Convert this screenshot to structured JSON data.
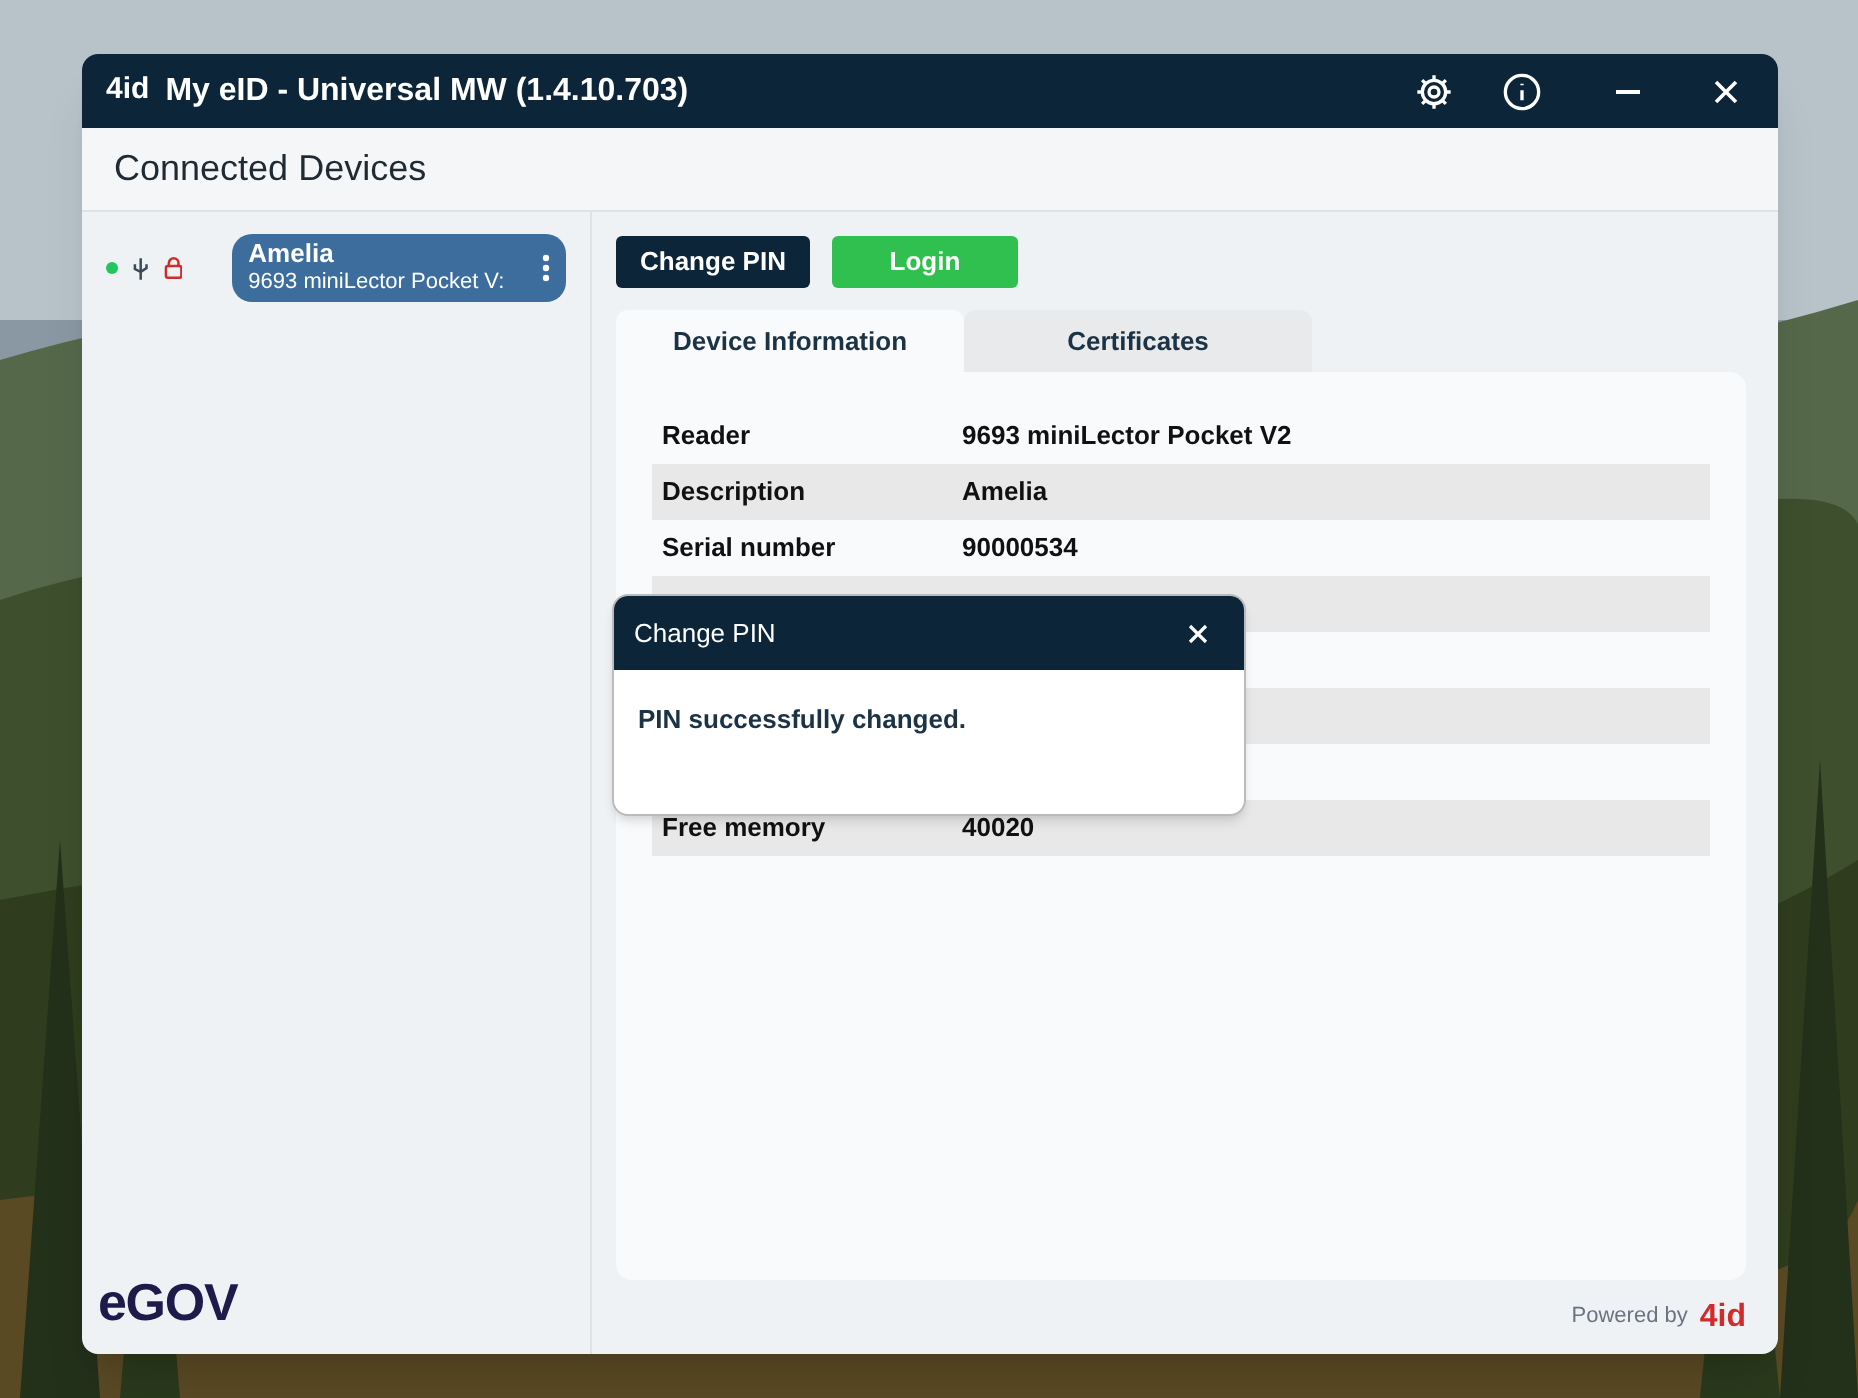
{
  "window": {
    "logo": "4id",
    "title": "My eID - Universal MW (1.4.10.703)"
  },
  "header": {
    "title": "Connected Devices"
  },
  "devices": [
    {
      "name": "Amelia",
      "reader": "9693 miniLector Pocket V:",
      "connected": true,
      "locked": true,
      "selected": true
    }
  ],
  "actions": [
    {
      "label": "Change PIN",
      "kind": "primary"
    },
    {
      "label": "Login",
      "kind": "success"
    }
  ],
  "tabs": [
    {
      "label": "Device Information",
      "selected": true
    },
    {
      "label": "Certificates",
      "selected": false
    }
  ],
  "table": {
    "rows": [
      {
        "kind": "info",
        "label": "Reader",
        "value": "9693 miniLector Pocket V2"
      },
      {
        "kind": "info",
        "label": "Description",
        "value": "Amelia"
      },
      {
        "kind": "info",
        "label": "Serial number",
        "value": "90000534"
      },
      {
        "kind": "covered"
      },
      {
        "kind": "covered"
      },
      {
        "kind": "covered"
      },
      {
        "kind": "covered"
      },
      {
        "kind": "info",
        "label": "Free memory",
        "value": "40020"
      }
    ]
  },
  "dialog": {
    "title": "Change PIN",
    "message": "PIN successfully changed."
  },
  "footer": {
    "brand": "eGOV",
    "powered_by": "Powered by",
    "powered_logo": "4id"
  }
}
